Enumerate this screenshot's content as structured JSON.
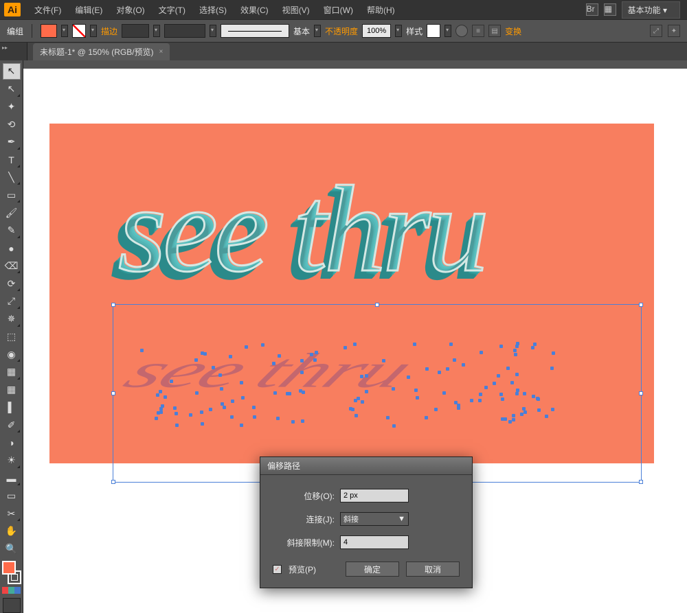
{
  "menubar": {
    "app": "Ai",
    "items": [
      "文件(F)",
      "编辑(E)",
      "对象(O)",
      "文字(T)",
      "选择(S)",
      "效果(C)",
      "视图(V)",
      "窗口(W)",
      "帮助(H)"
    ],
    "workspace": "基本功能"
  },
  "controlbar": {
    "mode": "编组",
    "stroke_label": "描边",
    "stroke_weight": "",
    "line_style": "基本",
    "opacity_label": "不透明度",
    "opacity_value": "100%",
    "style_label": "样式",
    "transform_label": "变换"
  },
  "tab": {
    "title": "未标题-1* @ 150% (RGB/预览)",
    "close": "×"
  },
  "artwork": {
    "main_text": "see thru",
    "shadow_text": "see thru"
  },
  "dialog": {
    "title": "偏移路径",
    "offset_label": "位移(O):",
    "offset_value": "2 px",
    "join_label": "连接(J):",
    "join_value": "斜接",
    "miter_label": "斜接限制(M):",
    "miter_value": "4",
    "preview_label": "预览(P)",
    "ok": "确定",
    "cancel": "取消"
  },
  "tools": {
    "selection": "↖",
    "direct": "↖",
    "wand": "✦",
    "lasso": "⟲",
    "pen": "✒",
    "type": "T",
    "line": "╲",
    "rect": "▭",
    "brush": "🖌",
    "pencil": "✎",
    "blob": "●",
    "eraser": "⌫",
    "rotate": "⟳",
    "scale": "⤢",
    "width": "✵",
    "free": "⬚",
    "shapebuild": "◉",
    "persp": "▦",
    "mesh": "▦",
    "gradient": "▌",
    "eyedrop": "✐",
    "blend": "◑",
    "symbol": "☀",
    "graph": "▬",
    "artboard": "▭",
    "slice": "✂",
    "hand": "✋",
    "zoom": "🔍"
  }
}
